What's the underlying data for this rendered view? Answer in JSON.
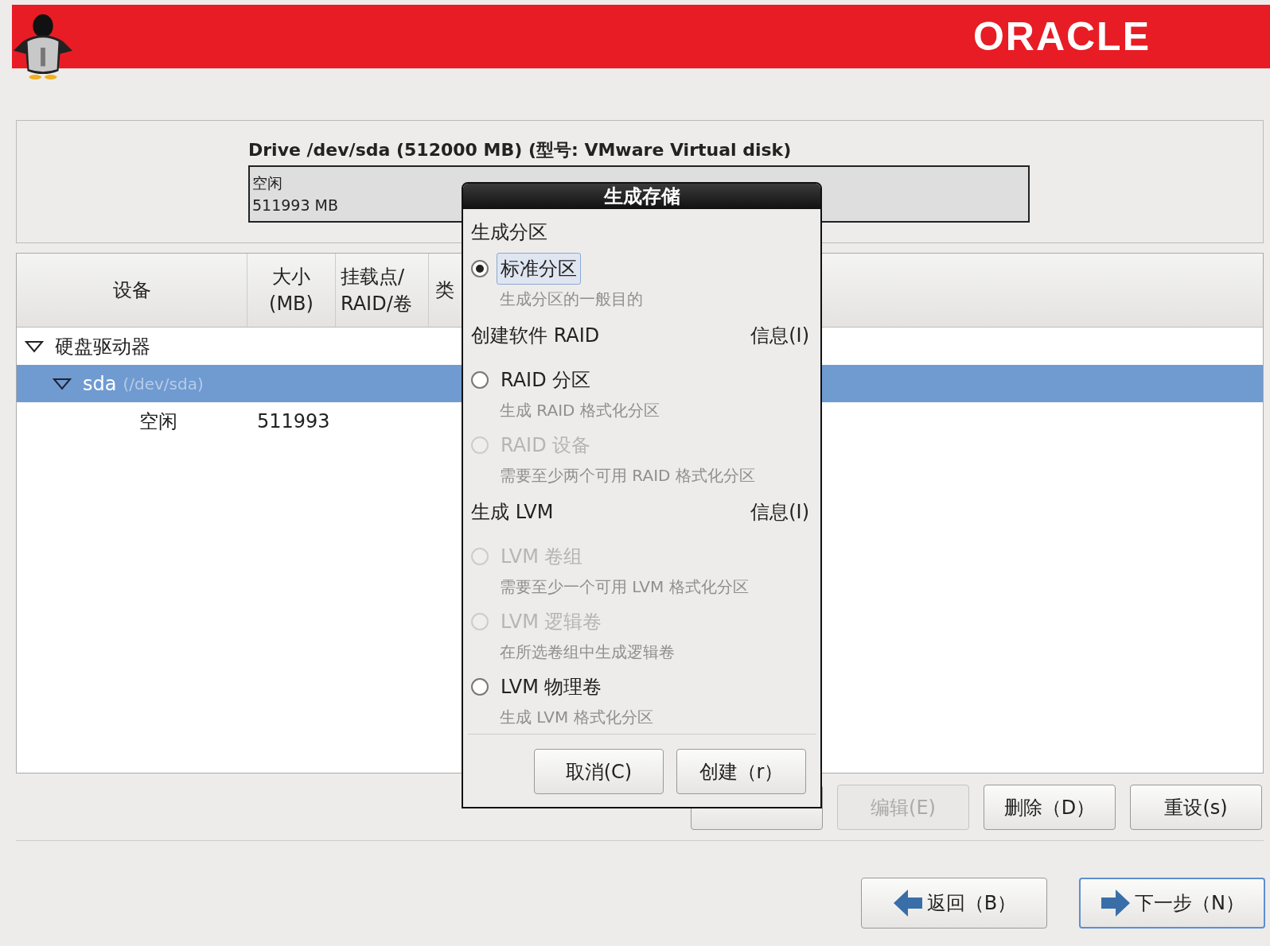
{
  "header": {
    "logo": "ORACLE"
  },
  "drive": {
    "title": "Drive /dev/sda (512000 MB) (型号: VMware Virtual disk)",
    "segment": {
      "label": "空闲",
      "size": "511993 MB"
    }
  },
  "table": {
    "columns": [
      {
        "lines": [
          "设备"
        ]
      },
      {
        "lines": [
          "大小",
          "(MB)"
        ]
      },
      {
        "lines": [
          "挂载点/",
          "RAID/卷"
        ]
      },
      {
        "lines": [
          "类"
        ]
      }
    ],
    "rows": [
      {
        "device": "硬盘驱动器",
        "expanded": true,
        "selected": false,
        "children": [
          {
            "device": "sda",
            "path": "(/dev/sda)",
            "expanded": true,
            "selected": true,
            "children": [
              {
                "device": "空闲",
                "size": "511993",
                "selected": false
              }
            ]
          }
        ]
      }
    ]
  },
  "actions": [
    {
      "disabled": false
    },
    {
      "label": "编辑(E)",
      "disabled": true
    },
    {
      "label": "删除（D）",
      "disabled": false
    },
    {
      "label": "重设(s)",
      "disabled": false
    }
  ],
  "nav": [
    {
      "label": "返回（B）",
      "kind": "back",
      "focused": false
    },
    {
      "label": "下一步（N）",
      "kind": "next",
      "focused": true
    }
  ],
  "dialog": {
    "title": "生成存储",
    "sections": [
      {
        "heading": "生成分区",
        "options": [
          {
            "label": "标准分区",
            "hint": "生成分区的一般目的",
            "selected": true,
            "disabled": false,
            "focused": true
          }
        ]
      },
      {
        "heading": "创建软件 RAID",
        "info": "信息(I)",
        "options": [
          {
            "label": "RAID 分区",
            "hint": "生成 RAID 格式化分区",
            "selected": false,
            "disabled": false,
            "focused": false
          },
          {
            "label": "RAID 设备",
            "hint": "需要至少两个可用 RAID 格式化分区",
            "selected": false,
            "disabled": true,
            "focused": false
          }
        ]
      },
      {
        "heading": "生成 LVM",
        "info": "信息(I)",
        "options": [
          {
            "label": "LVM 卷组",
            "hint": "需要至少一个可用 LVM 格式化分区",
            "selected": false,
            "disabled": true,
            "focused": false
          },
          {
            "label": "LVM 逻辑卷",
            "hint": "在所选卷组中生成逻辑卷",
            "selected": false,
            "disabled": true,
            "focused": false
          },
          {
            "label": "LVM 物理卷",
            "hint": "生成 LVM 格式化分区",
            "selected": false,
            "disabled": false,
            "focused": false
          }
        ]
      }
    ],
    "buttons": [
      "取消(C)",
      "创建（r）"
    ]
  }
}
